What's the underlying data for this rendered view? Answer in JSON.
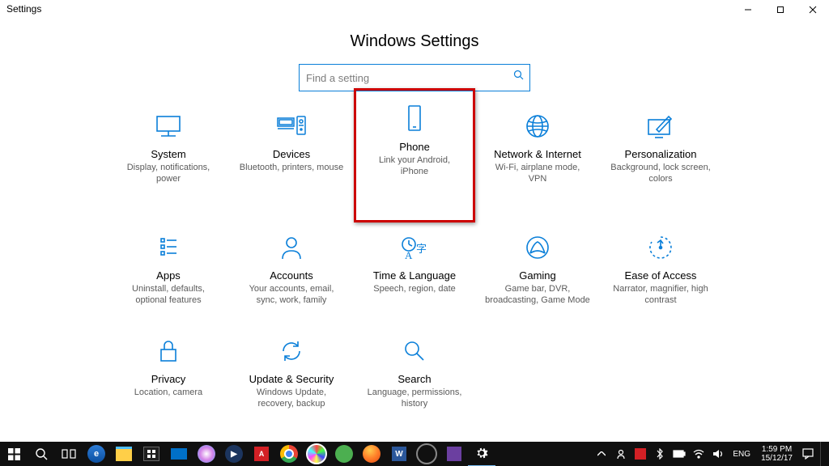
{
  "window": {
    "title": "Settings"
  },
  "page": {
    "title": "Windows Settings"
  },
  "search": {
    "placeholder": "Find a setting",
    "value": ""
  },
  "tiles": [
    {
      "label": "System",
      "desc": "Display, notifications, power"
    },
    {
      "label": "Devices",
      "desc": "Bluetooth, printers, mouse"
    },
    {
      "label": "Phone",
      "desc": "Link your Android, iPhone"
    },
    {
      "label": "Network & Internet",
      "desc": "Wi-Fi, airplane mode, VPN"
    },
    {
      "label": "Personalization",
      "desc": "Background, lock screen, colors"
    },
    {
      "label": "Apps",
      "desc": "Uninstall, defaults, optional features"
    },
    {
      "label": "Accounts",
      "desc": "Your accounts, email, sync, work, family"
    },
    {
      "label": "Time & Language",
      "desc": "Speech, region, date"
    },
    {
      "label": "Gaming",
      "desc": "Game bar, DVR, broadcasting, Game Mode"
    },
    {
      "label": "Ease of Access",
      "desc": "Narrator, magnifier, high contrast"
    },
    {
      "label": "Privacy",
      "desc": "Location, camera"
    },
    {
      "label": "Update & Security",
      "desc": "Windows Update, recovery, backup"
    },
    {
      "label": "Search",
      "desc": "Language, permissions, history"
    }
  ],
  "taskbar": {
    "language": "ENG",
    "time": "1:59 PM",
    "date": "15/12/17"
  },
  "colors": {
    "accent": "#0a7fd9",
    "highlight": "#c00000"
  }
}
